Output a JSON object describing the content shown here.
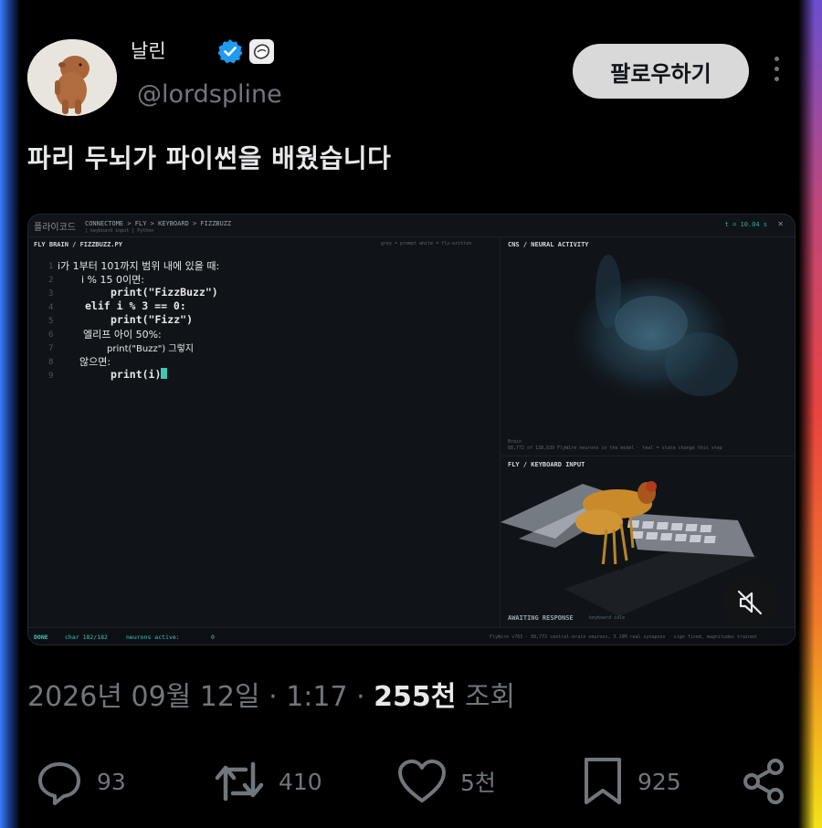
{
  "author": {
    "name": "날린",
    "handle": "@lordspline"
  },
  "header": {
    "follow_label": "팔로우하기"
  },
  "tweet": {
    "text": "파리 두뇌가 파이썬을 배웠습니다"
  },
  "media": {
    "app_title": "플라이코드",
    "breadcrumb": "CONNECTOME > FLY > KEYBOARD > FIZZBUZZ",
    "breadcrumb_sub": "[  keyboard input  ]   Python",
    "timer": "t = 10.04 s",
    "editor_title": "FLY BRAIN / FIZZBUZZ.PY",
    "editor_legend": "grey = prompt    white = fly-written",
    "code_lines": [
      {
        "n": "1",
        "text": "i가 1부터 101까지 범위 내에 있을 때:"
      },
      {
        "n": "2",
        "text": "i % 15 0이면:"
      },
      {
        "n": "3",
        "text": "print(\"FizzBuzz\")"
      },
      {
        "n": "4",
        "text": "elif i % 3 == 0:"
      },
      {
        "n": "5",
        "text": "print(\"Fizz\")"
      },
      {
        "n": "6",
        "text": "엘리프 아이 50%:"
      },
      {
        "n": "7",
        "text": "print(\"Buzz\") 그렇지"
      },
      {
        "n": "8",
        "text": "않으면:"
      },
      {
        "n": "9",
        "text": "print(i)"
      }
    ],
    "cns_title": "CNS / NEURAL ACTIVITY",
    "cns_caption_1": "Brain",
    "cns_caption_2": "88,772 of 138,639 FlyWire neurons in the model  ·  teal = state change this step",
    "fly_title": "FLY / KEYBOARD INPUT",
    "awaiting": "AWAITING RESPONSE",
    "awaiting_sub": "keyboard idle",
    "status_done": "DONE",
    "status_char": "char 182/182",
    "status_neurons_label": "neurons active:",
    "status_neurons_value": "0",
    "status_right": "FlyWire v783  ·  88,772 central-brain neurons, 3.19M real synapses  ·  sign fixed, magnitudes trained"
  },
  "meta": {
    "date": "2026년 09월 12일",
    "time": "1:17",
    "views_value": "255천",
    "views_label": "조회"
  },
  "actions": {
    "replies": "93",
    "reposts": "410",
    "likes": "5천",
    "bookmarks": "925"
  },
  "icons": [
    "verified-badge-icon",
    "affiliate-badge-icon",
    "more-icon",
    "mute-icon",
    "reply-icon",
    "repost-icon",
    "like-icon",
    "bookmark-icon",
    "share-icon"
  ],
  "colors": {
    "accent_teal": "#3ec7b4",
    "verified_blue": "#1d9bf0",
    "secondary_text": "#71767b"
  }
}
